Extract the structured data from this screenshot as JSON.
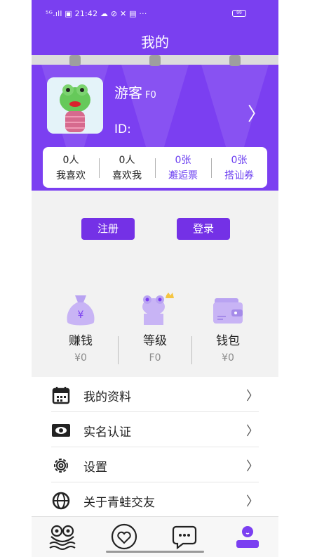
{
  "status": {
    "text": "⁵ᴳ.ıll ▣ 21:42 ☁ ⊘ ✕ ▤ ···",
    "battery": "99"
  },
  "title": "我的",
  "profile": {
    "name": "游客",
    "level": "F0",
    "id_label": "ID:"
  },
  "stats": [
    {
      "value": "0人",
      "label": "我喜欢"
    },
    {
      "value": "0人",
      "label": "喜欢我"
    },
    {
      "value": "0张",
      "label": "邂逅票"
    },
    {
      "value": "0张",
      "label": "搭讪券"
    }
  ],
  "buttons": {
    "register": "注册",
    "login": "登录"
  },
  "features": [
    {
      "label": "赚钱",
      "value": "¥0",
      "icon": "money-bag-icon"
    },
    {
      "label": "等级",
      "value": "F0",
      "icon": "frog-crown-icon"
    },
    {
      "label": "钱包",
      "value": "¥0",
      "icon": "wallet-icon"
    }
  ],
  "menu": [
    {
      "label": "我的资料",
      "icon": "calendar-icon"
    },
    {
      "label": "实名认证",
      "icon": "id-card-icon"
    },
    {
      "label": "设置",
      "icon": "gear-icon"
    },
    {
      "label": "关于青蛙交友",
      "icon": "globe-icon"
    }
  ],
  "tabs": [
    "frog-home-icon",
    "heart-icon",
    "chat-icon",
    "profile-icon"
  ],
  "colors": {
    "primary": "#7b3ff1",
    "button": "#7431e6",
    "accent_text": "#6a3df0"
  }
}
